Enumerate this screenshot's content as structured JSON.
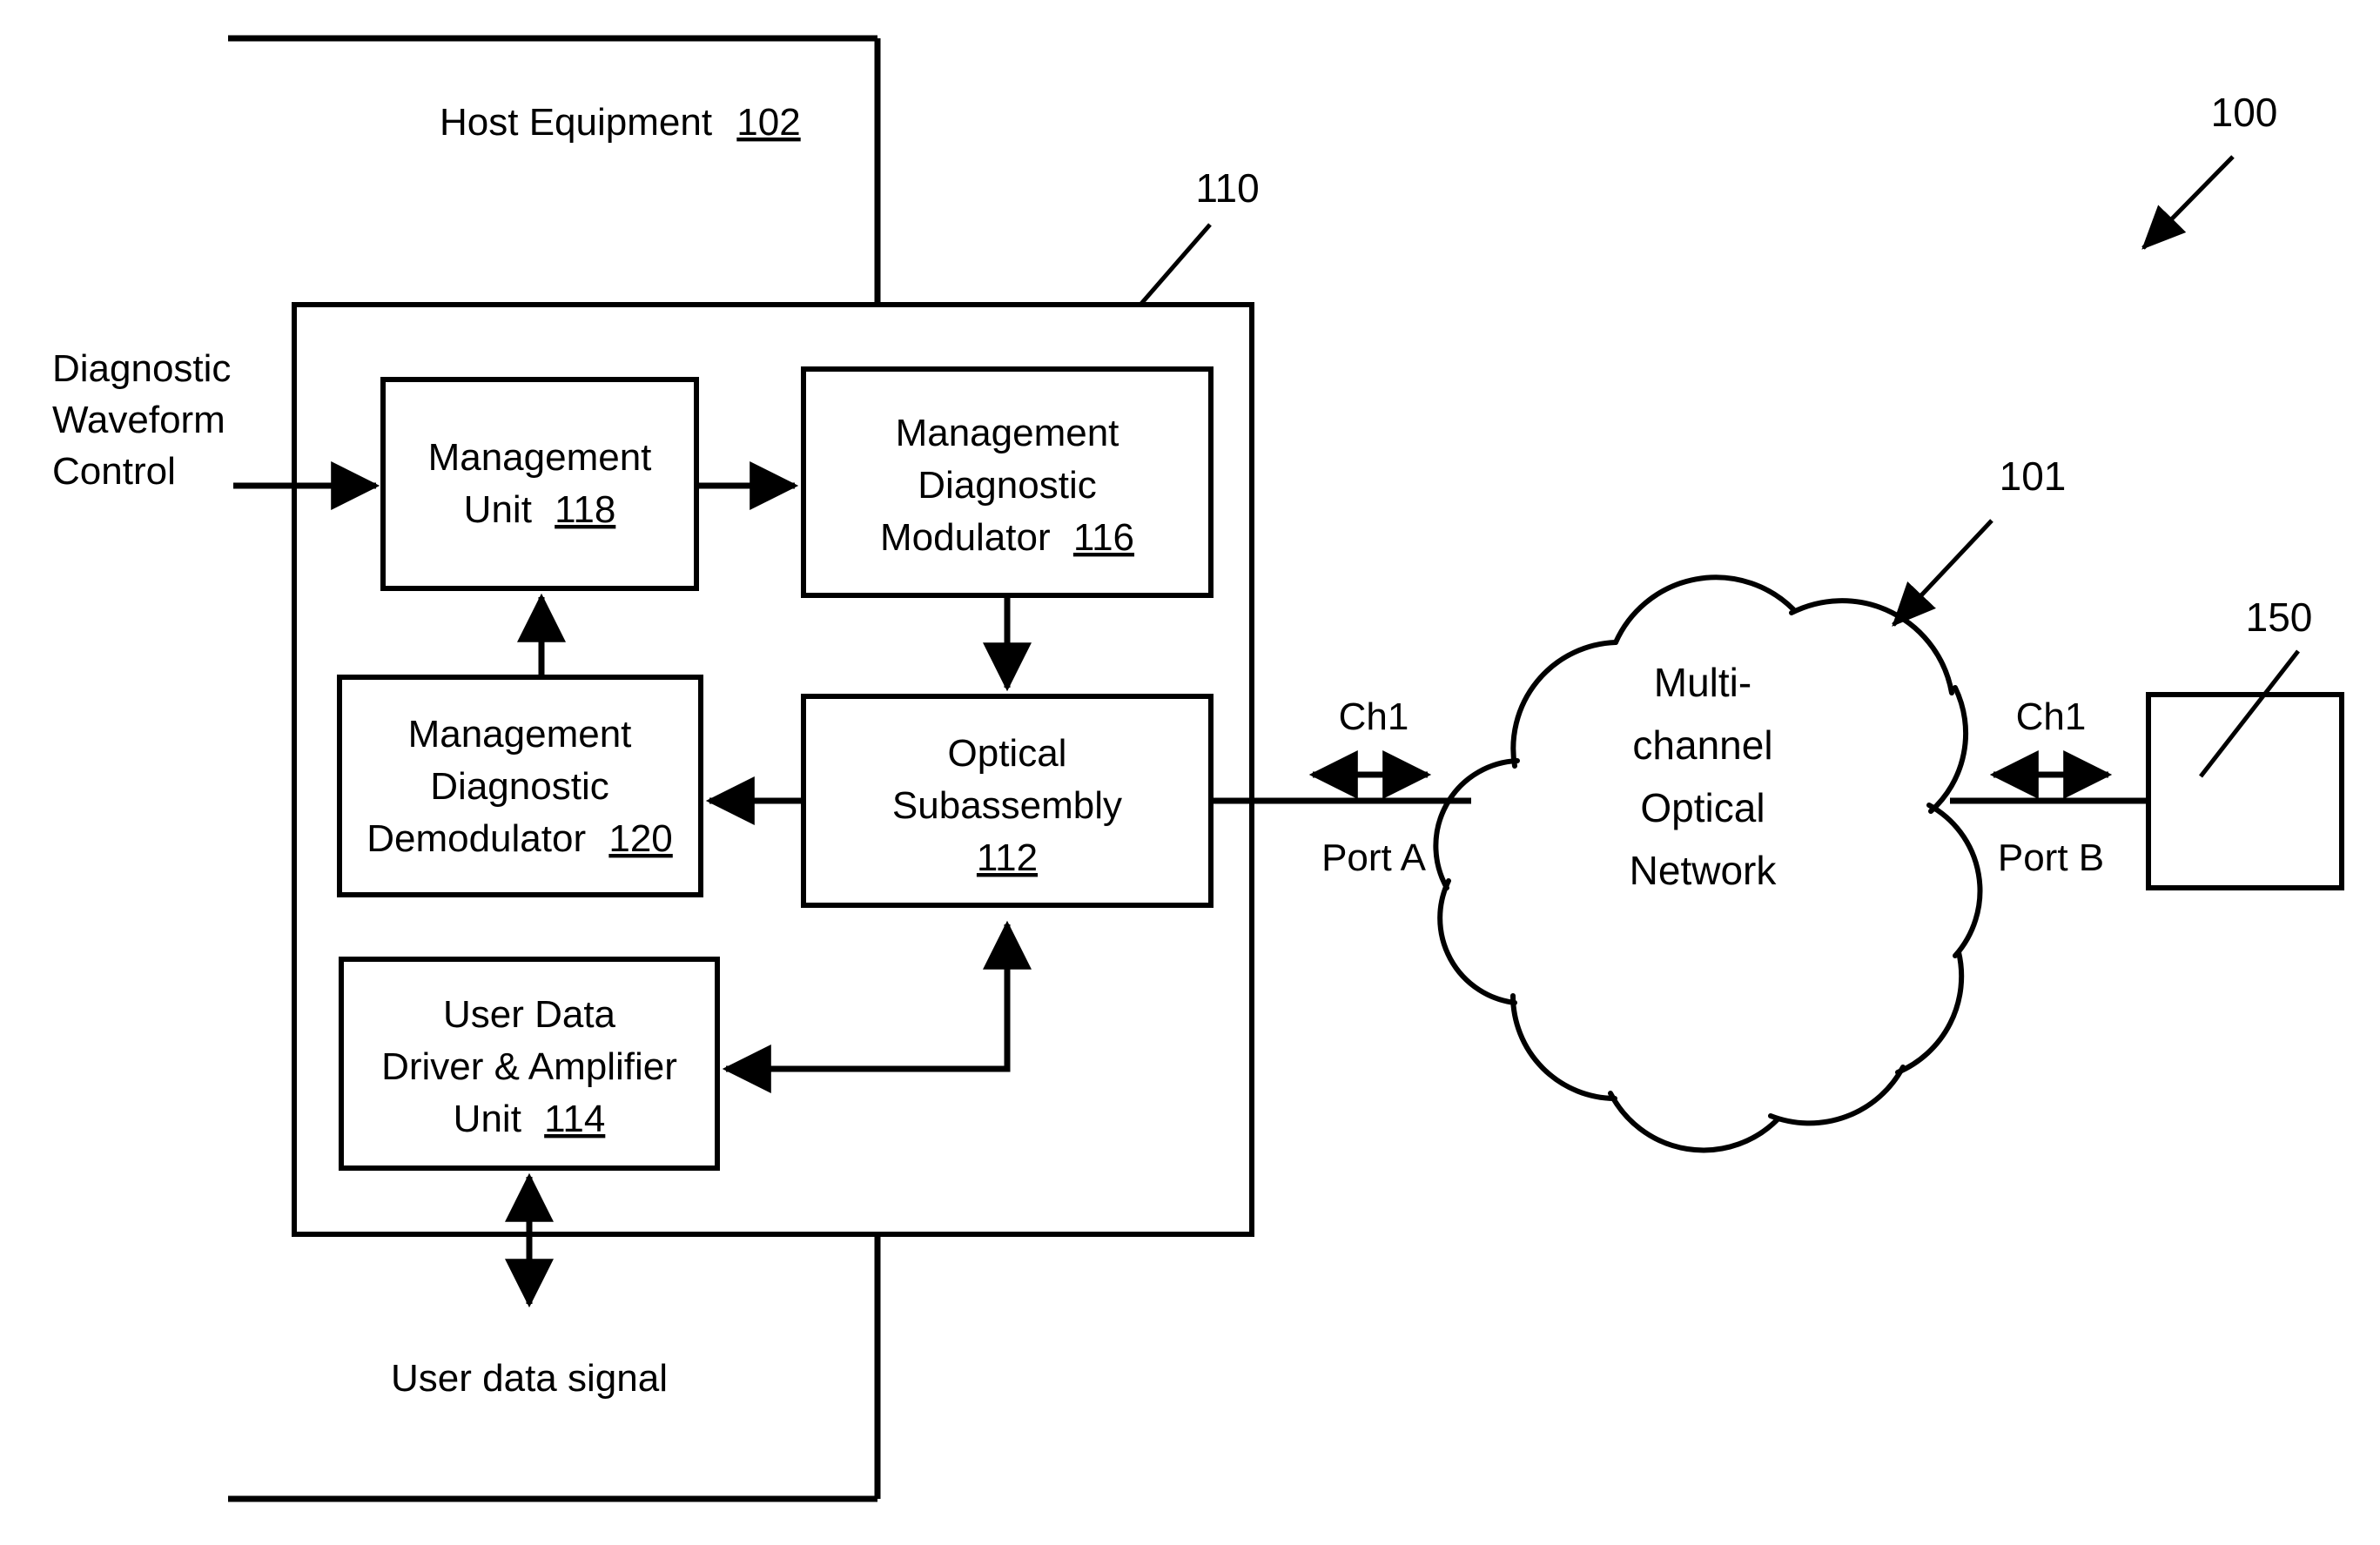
{
  "figure": {
    "reference_numeral": "100",
    "host_equipment_label": "Host Equipment",
    "host_equipment_num": "102",
    "transceiver_ref": "110",
    "network_ref": "101",
    "far_end_ref": "150"
  },
  "external_labels": {
    "diagnostic_waveform_control_line1": "Diagnostic",
    "diagnostic_waveform_control_line2": "Waveform",
    "diagnostic_waveform_control_line3": "Control",
    "user_data_signal": "User data signal"
  },
  "blocks": [
    {
      "id": "management-unit",
      "lines": [
        "Management",
        "Unit"
      ],
      "num": "118"
    },
    {
      "id": "management-diagnostic-modulator",
      "lines": [
        "Management",
        "Diagnostic",
        "Modulator"
      ],
      "num": "116"
    },
    {
      "id": "management-diagnostic-demodulator",
      "lines": [
        "Management",
        "Diagnostic",
        "Demodulator"
      ],
      "num": "120"
    },
    {
      "id": "optical-subassembly",
      "lines": [
        "Optical",
        "Subassembly"
      ],
      "num": "112"
    },
    {
      "id": "user-data-driver-amplifier-unit",
      "lines": [
        "User Data",
        "Driver & Amplifier",
        "Unit"
      ],
      "num": "114"
    }
  ],
  "network": {
    "cloud_line1": "Multi-",
    "cloud_line2": "channel",
    "cloud_line3": "Optical",
    "cloud_line4": "Network"
  },
  "ports": {
    "left_channel": "Ch1",
    "left_port": "Port A",
    "right_channel": "Ch1",
    "right_port": "Port B"
  },
  "colors": {
    "line": "#000000",
    "background": "#ffffff",
    "text": "#000000"
  }
}
